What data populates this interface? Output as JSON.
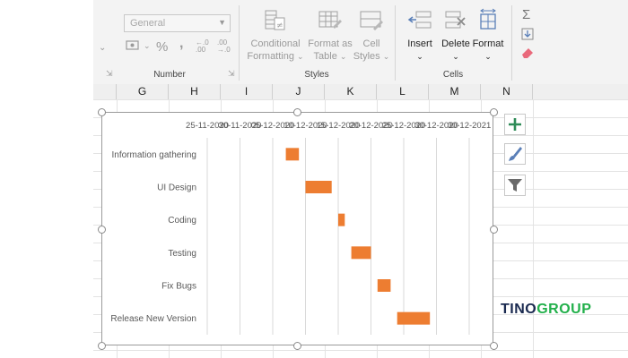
{
  "ribbon": {
    "number_format_value": "General",
    "percent_symbol": "%",
    "comma_symbol": ",",
    "number_group_label": "Number",
    "styles_group_label": "Styles",
    "cells_group_label": "Cells",
    "conditional_formatting": [
      "Conditional",
      "Formatting"
    ],
    "format_as_table": [
      "Format as",
      "Table"
    ],
    "cell_styles": [
      "Cell",
      "Styles"
    ],
    "insert_label": "Insert",
    "delete_label": "Delete",
    "format_label": "Format",
    "sigma_symbol": "Σ"
  },
  "columns": [
    "G",
    "H",
    "I",
    "J",
    "K",
    "L",
    "M",
    "N"
  ],
  "chart_data": {
    "type": "bar",
    "orientation": "horizontal-gantt",
    "title": "",
    "categories": [
      "Information gathering",
      "UI Design",
      "Coding",
      "Testing",
      "Fix Bugs",
      "Release New Version"
    ],
    "x_tick_labels": [
      "25-11-2020",
      "30-11-2020",
      "05-12-2020",
      "10-12-2020",
      "15-12-2020",
      "20-12-2020",
      "25-12-2020",
      "30-12-2020",
      "04-01-2021"
    ],
    "x_tick_labels_visible": [
      "25-11-2020",
      "30-11-2020",
      "05-12-2020",
      "10-12-2020",
      "15-12-2020",
      "20-12-2020",
      "25-12-2020",
      "30-12-2020",
      "30-12-2021"
    ],
    "xlim": [
      "2020-11-25",
      "2021-01-04"
    ],
    "series": [
      {
        "name": "Duration",
        "start": [
          "2020-12-07",
          "2020-12-10",
          "2020-12-15",
          "2020-12-17",
          "2020-12-21",
          "2020-12-24"
        ],
        "end": [
          "2020-12-09",
          "2020-12-14",
          "2020-12-16",
          "2020-12-20",
          "2020-12-23",
          "2020-12-29"
        ]
      }
    ],
    "bar_color": "#ed7d31",
    "grid": true,
    "legend": "none"
  },
  "brand": {
    "part1": "TINO",
    "part2": "GROUP",
    "color1": "#1a2a50",
    "color2": "#22b04b"
  }
}
